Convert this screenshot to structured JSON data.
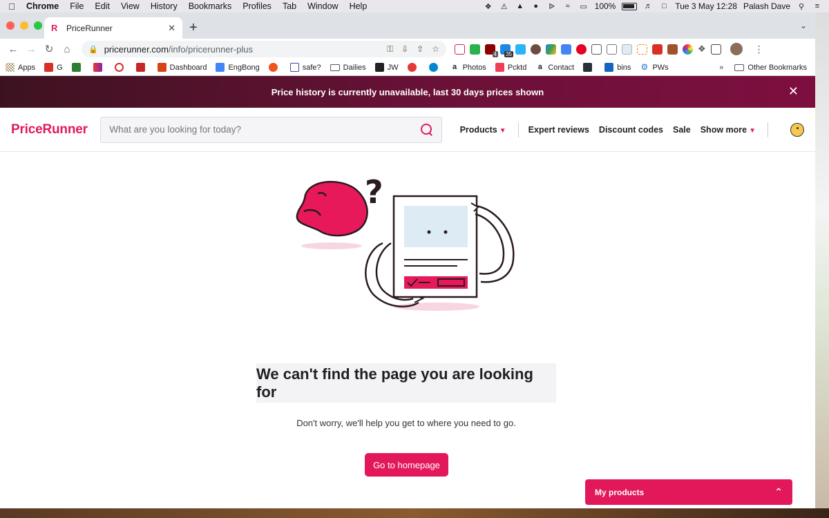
{
  "menubar": {
    "app": "Chrome",
    "items": [
      "File",
      "Edit",
      "View",
      "History",
      "Bookmarks",
      "Profiles",
      "Tab",
      "Window",
      "Help"
    ],
    "battery": "100%",
    "datetime": "Tue 3 May  12:28",
    "user": "Palash Dave"
  },
  "tab": {
    "title": "PriceRunner"
  },
  "omnibox": {
    "host": "pricerunner.com",
    "path": "/info/pricerunner-plus"
  },
  "extensions": {
    "badge_1": "4",
    "badge_2": "35"
  },
  "bookmarks": {
    "items": [
      "Apps",
      "G",
      "Dashboard",
      "EngBong",
      "safe?",
      "Dailies",
      "JW",
      "Photos",
      "Pcktd",
      "Contact",
      "bins",
      "PWs"
    ],
    "more": "»",
    "other": "Other Bookmarks"
  },
  "banner": {
    "text": "Price history is currently unavailable, last 30 days prices shown"
  },
  "header": {
    "logo": "PriceRunner",
    "search_placeholder": "What are you looking for today?",
    "nav": {
      "products": "Products",
      "expert_reviews": "Expert reviews",
      "discount_codes": "Discount codes",
      "sale": "Sale",
      "show_more": "Show more"
    }
  },
  "error": {
    "title": "We can't find the page you are looking for",
    "subtitle": "Don't worry, we'll help you get to where you need to go.",
    "button": "Go to homepage"
  },
  "my_products": {
    "label": "My products"
  },
  "colors": {
    "brand": "#e2185b",
    "banner_dark": "#3d1220",
    "banner_light": "#7d0f3f"
  }
}
